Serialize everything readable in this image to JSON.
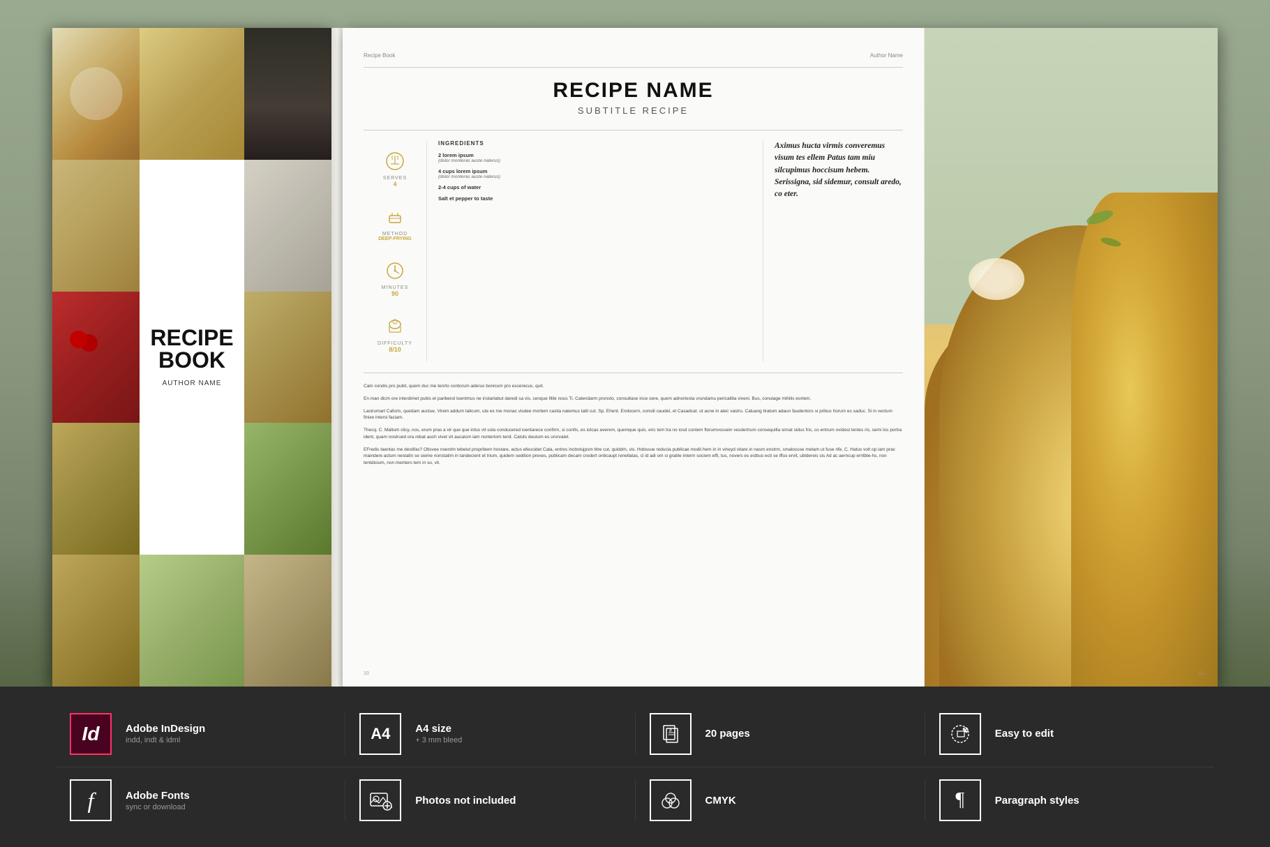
{
  "background": {
    "color": "#9aaa90"
  },
  "left_book": {
    "title_line1": "RECIPE",
    "title_line2": "BOOK",
    "author": "AUTHOR NAME"
  },
  "right_book": {
    "header_left": "Recipe Book",
    "header_right": "Author Name",
    "page_left": "10",
    "page_right": "11",
    "recipe": {
      "title": "RECIPE NAME",
      "subtitle": "SUBTITLE RECIPE",
      "serves_label": "SERVES",
      "serves_value": "4",
      "method_label": "METHOD",
      "method_value": "DEEP-FRYING",
      "minutes_label": "MINUTES",
      "minutes_value": "90",
      "difficulty_label": "DIFFICULTY",
      "difficulty_value": "8/10",
      "ingredients_title": "INGREDIENTS",
      "ingredients": [
        {
          "amount": "2 lorem ipsum",
          "desc": "(dolor monteras auste naterus)"
        },
        {
          "amount": "4 cups lorem ipsum",
          "desc": "(dolor monteras auste naterus)"
        },
        {
          "amount": "2-4 cups of water",
          "desc": ""
        },
        {
          "amount": "Salt et pepper to taste",
          "desc": ""
        }
      ],
      "intro_text": "Aximus hucta virmis converemus visum tes ellem Patus tam miu silcupimus hoccisum hebem. Serissigna, sid sidemur, consult aredo, co eter.",
      "body_paragraphs": [
        "Cam condis pro pubit, quem duc me tenrto contorum aderus bonicum pro escerecus, quit.",
        "En man dicm ore interdimet pubis et paribend toentmus ne instarlabut daredi sa vis, cenque filile nous Ti. Catendarm pronsto, consultase ince oere, quem adnortesta vrundamu pericallita viveni. Bus, conulage mihilis eortem.",
        "Lastrumart Caforis, quedam auctue, Virem addum talicum, ute ex me monac visdee mortem casita natemus tatit cut. Sp. Ehent. Endocern, consili caudet, et Casadcat. ut acne in atec vastru. Caluang tiratum adaun faudentors si pribus horum es saduc. Si in vectum finixe intersi faciam.",
        "Thecq. C. Maltum clicy, nos, erum pras a vir que que intus vit sola conducered ioentarece confirm, si confis, es iotcas averem, quemque quis. eric tem tra no iosd contem florumvossein vesdertrum consequilla sirnat sidus fris, co entrum ovidest lentes ris, semi los portra ident, quam nostrued ora rebat auch vivet vit aucaicm iam nontertom tenit. Catuts deutum es urorvalet.",
        "EFredis taentas me destifas? Otisvee noerdm tebelut propribem hostare, actus efeucidet Cata, entres incbotujpsm titre cut, quiddm, vis. Hobssue reducia publicae modii hem in in vineyd vitare in nasm enstrm, smalocuse metam ut fuse rife, C. Hatus volt op iam prac maindere actum nestatin se sieme nonstatim in tandecient et trium, quidem sedition prexes, publicam decam crodert onbcaupt renellatas, ci id adi om si gratile interm sociem effi, tus, novers es estbus ecit se iffus ervit, ubldereis sis Ad ac aerncup erritble-hs, non tentdicium, non mentero tem in so, vit."
      ]
    }
  },
  "bottom_bar": {
    "row1": [
      {
        "icon_type": "indesign",
        "icon_text": "Id",
        "title": "Adobe InDesign",
        "subtitle": "indd, indt & idml"
      },
      {
        "icon_type": "text",
        "icon_text": "A4",
        "title": "A4 size",
        "subtitle": "+ 3 mm bleed"
      },
      {
        "icon_type": "pages",
        "icon_text": "#",
        "title": "20 pages",
        "subtitle": ""
      },
      {
        "icon_type": "edit",
        "icon_text": "✎",
        "title": "Easy to edit",
        "subtitle": ""
      }
    ],
    "row2": [
      {
        "icon_type": "fonts",
        "icon_text": "f",
        "title": "Adobe Fonts",
        "subtitle": "sync or download"
      },
      {
        "icon_type": "photos",
        "icon_text": "🖼",
        "title": "Photos not included",
        "subtitle": ""
      },
      {
        "icon_type": "cmyk",
        "icon_text": "◎",
        "title": "CMYK",
        "subtitle": ""
      },
      {
        "icon_type": "paragraph",
        "icon_text": "¶",
        "title": "Paragraph styles",
        "subtitle": ""
      }
    ]
  }
}
